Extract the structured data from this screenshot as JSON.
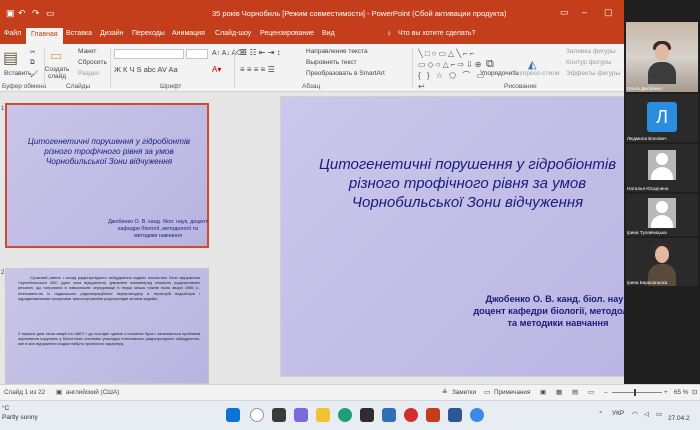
{
  "window": {
    "title": "35 років Чорнобиль [Режим совместимости] - PowerPoint (Сбой активации продукта)",
    "qa_icons": [
      "save-icon",
      "undo-icon",
      "redo-icon",
      "start-from-beginning-icon"
    ]
  },
  "tabs": [
    {
      "label": "Файл"
    },
    {
      "label": "Главная",
      "active": true
    },
    {
      "label": "Вставка"
    },
    {
      "label": "Дизайн"
    },
    {
      "label": "Переходы"
    },
    {
      "label": "Анимация"
    },
    {
      "label": "Слайд-шоу"
    },
    {
      "label": "Рецензирование"
    },
    {
      "label": "Вид"
    }
  ],
  "tell_me": "Что вы хотите сделать?",
  "ribbon": {
    "clipboard": {
      "paste": "Вставить",
      "cut": "Вырезать",
      "copy": "Копировать",
      "group": "Буфер обмена"
    },
    "slides": {
      "new_slide": "Создать слайд",
      "layout": "Макет",
      "reset": "Сбросить",
      "section": "Раздел",
      "group": "Слайды"
    },
    "font": {
      "group": "Шрифт",
      "format_row": "Ж  К  Ч  S  abc  AV  Aa"
    },
    "paragraph": {
      "group": "Абзац",
      "text_direction": "Направление текста",
      "align_text": "Выровнять текст",
      "smartart": "Преобразовать в SmartArt"
    },
    "drawing": {
      "group": "Рисование",
      "arrange": "Упорядочить",
      "quick_styles": "Экспресс-стили",
      "fill": "Заливка фигуры",
      "outline": "Контур фигуры",
      "effects": "Эффекты фигуры"
    }
  },
  "slides": [
    {
      "number": "1",
      "title": "Цитогенетичні порушення у гідробіонтів різного трофічного рівня за умов Чорнобильської Зони відчуження",
      "author": "Джобенко О. В. канд. біол. наук, доцент кафедри біології, методології та методики навчання"
    },
    {
      "number": "2",
      "body": [
        "Сучасний рівень і склад радіонуклідного забруднення водних екосистем Зони відчуження Чорнобильської АЕС (далі зона відчуження) зумовлені насамперед кількістю радіоактивних речовин, що потрапили в навколишнє середовище в перші кілька тижнів після аварії 1986 р., інтенсивністю їх подальшого радіоміграційного перерозподілу в територій водозборів і гідродинамічними процесами транспортування радіонуклідів за межі водойм.",
        "З перших днів після аварії на ЧАЕС і до сьогодні однією з головних була і залишається проблема оцінювання порушень у біологічних системах унаслідок інтенсивного радіонуклідного забруднення, яке в зоні відчуження згодом набуло хронічного характеру."
      ]
    }
  ],
  "main_slide": {
    "title": "Цитогенетичні порушення у гідробіонтів різного трофічного рівня за умов Чорнобильської Зони відчуження",
    "author": "Джобенко О. В. канд. біол. наук, доцент кафедри біології, методології та методики навчання"
  },
  "status": {
    "slide_counter": "Слайд 1 из 22",
    "language": "английский (США)",
    "notes": "Заметки",
    "comments": "Примечания",
    "zoom": "65 %"
  },
  "participants": [
    {
      "name": "Ольга Джобенко"
    },
    {
      "name": "Людмила Волович",
      "initial": "Л"
    },
    {
      "name": "Наталья Юсадчина"
    },
    {
      "name": "Ірина Тулавчицька"
    },
    {
      "name": "Ірина Барасаньска"
    }
  ],
  "taskbar": {
    "weather_temp": "°C",
    "weather_desc": "Partly sunny",
    "lang": "УКР",
    "date": "27.04.2"
  }
}
